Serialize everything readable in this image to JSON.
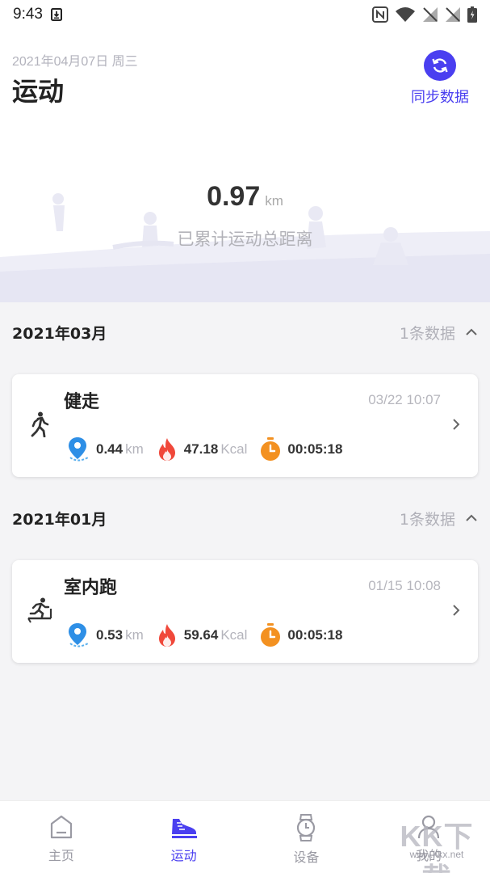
{
  "status_bar": {
    "time": "9:43",
    "icons": [
      "download-icon",
      "nfc-icon",
      "wifi-icon",
      "signal-off-icon",
      "signal-off-icon",
      "battery-icon"
    ]
  },
  "header": {
    "date": "2021年04月07日 周三",
    "title": "运动",
    "sync_label": "同步数据",
    "total_value": "0.97",
    "total_unit": "km",
    "total_caption": "已累计运动总距离"
  },
  "months": [
    {
      "title": "2021年03月",
      "count": "1条数据",
      "records": [
        {
          "name": "健走",
          "time": "03/22 10:07",
          "icon": "walking-icon",
          "distance": "0.44",
          "distance_unit": "km",
          "calories": "47.18",
          "calories_unit": "Kcal",
          "duration": "00:05:18"
        }
      ]
    },
    {
      "title": "2021年01月",
      "count": "1条数据",
      "records": [
        {
          "name": "室内跑",
          "time": "01/15 10:08",
          "icon": "treadmill-icon",
          "distance": "0.53",
          "distance_unit": "km",
          "calories": "59.64",
          "calories_unit": "Kcal",
          "duration": "00:05:18"
        }
      ]
    }
  ],
  "bottom_nav": [
    {
      "label": "主页",
      "icon": "home-icon",
      "active": false
    },
    {
      "label": "运动",
      "icon": "shoe-icon",
      "active": true
    },
    {
      "label": "设备",
      "icon": "watch-icon",
      "active": false
    },
    {
      "label": "我的",
      "icon": "profile-icon",
      "active": false
    }
  ],
  "watermark": {
    "text": "KK下载",
    "url": "www.kkx.net"
  },
  "colors": {
    "accent": "#4a3ff0",
    "location": "#2e8fe6",
    "fire": "#f0483a",
    "timer": "#f39121"
  }
}
